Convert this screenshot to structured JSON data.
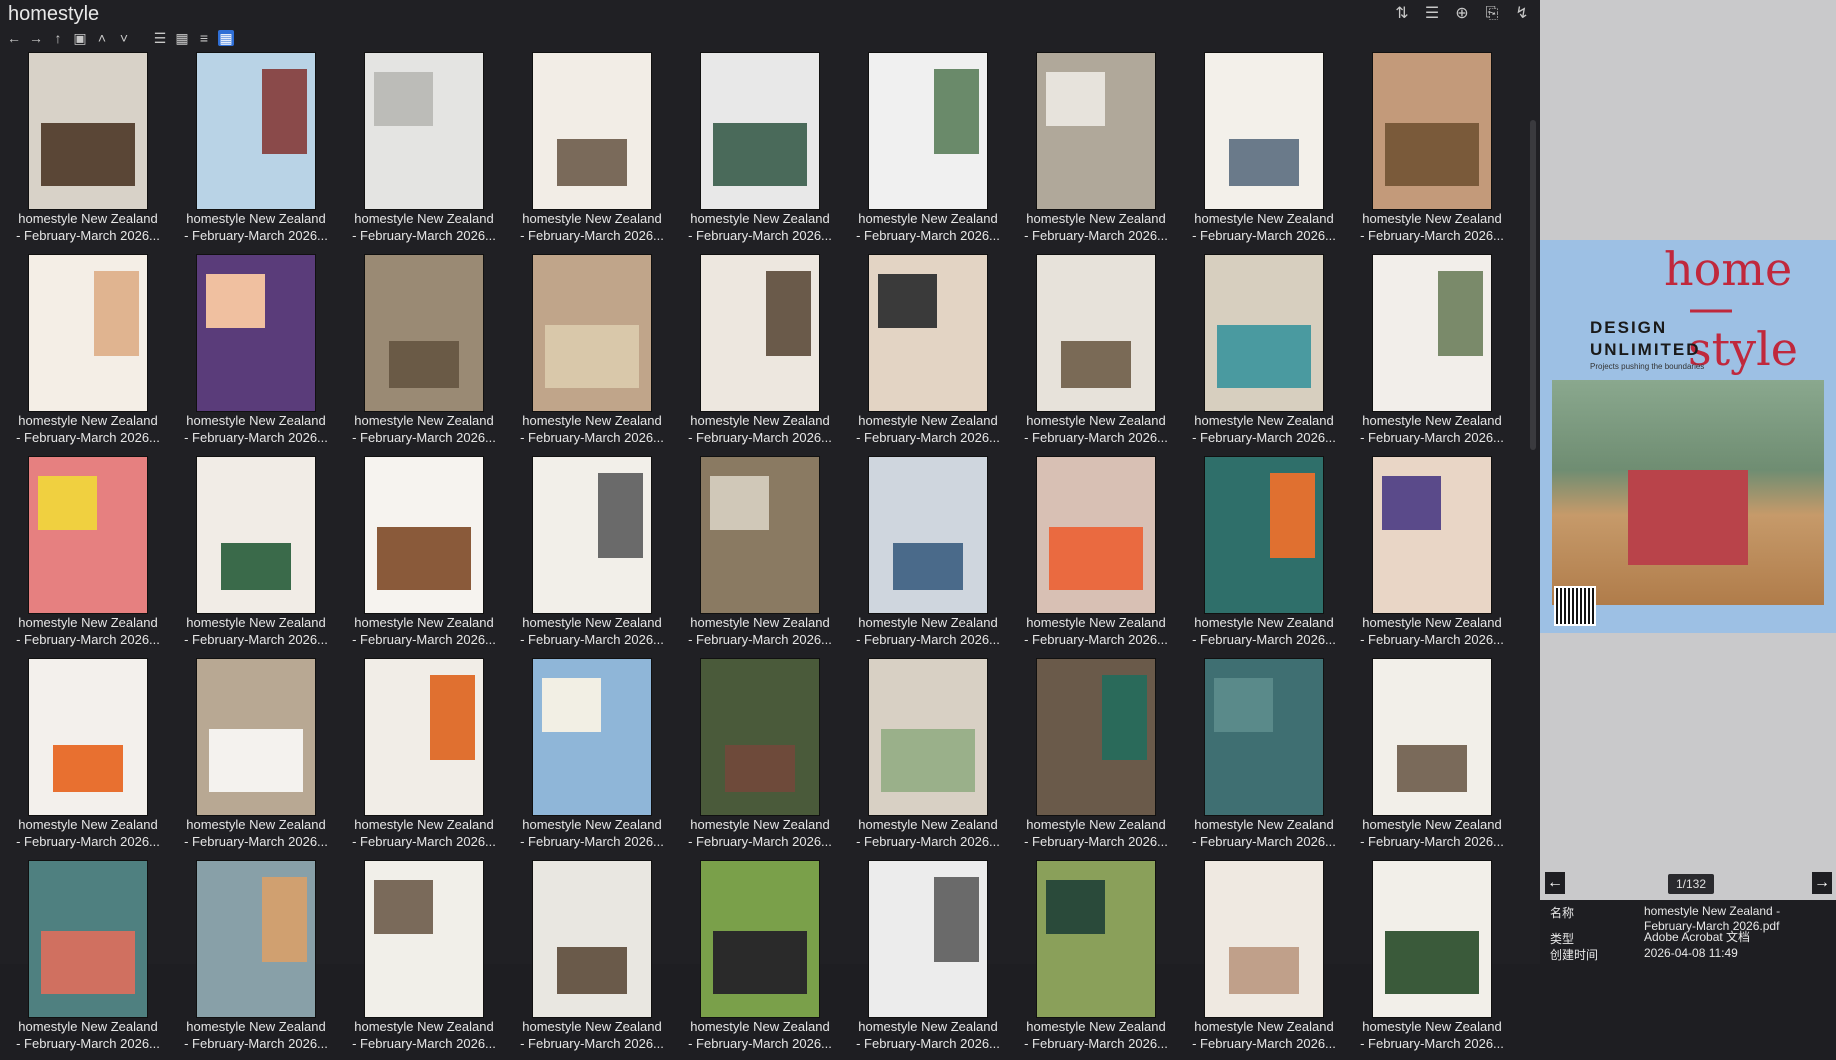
{
  "app": {
    "title": "homestyle"
  },
  "toolbar": {
    "icons": [
      "back-arrow-icon",
      "forward-arrow-icon",
      "up-arrow-icon",
      "crop-icon",
      "chevron-up-icon",
      "chevron-down-icon",
      "list-view-icon",
      "details-view-icon",
      "tree-view-icon",
      "grid-view-icon"
    ],
    "right_icons": [
      "sort-icon",
      "list-options-icon",
      "add-icon",
      "clipboard-icon",
      "bolt-icon"
    ]
  },
  "grid": {
    "caption_line1": "homestyle New Zealand",
    "caption_line2": "- February-March 2026...",
    "thumb_colors": [
      "#d8d2c8",
      "#b9d3e6",
      "#e4e4e2",
      "#f2ede6",
      "#e8e8e8",
      "#f0f0f0",
      "#b0a89a",
      "#f3f0ea",
      "#c39a7a",
      "#f4eee6",
      "#5a3c7a",
      "#9a8a74",
      "#c0a58a",
      "#ede7df",
      "#e3d4c4",
      "#e7e2da",
      "#d7cfbf",
      "#f2eeea",
      "#e68080",
      "#f1ece6",
      "#f6f3ef",
      "#f2efe9",
      "#8a7a62",
      "#cfd6de",
      "#d8c0b4",
      "#2f6f6a",
      "#e9d6c6",
      "#f3f0ec",
      "#b8a893",
      "#f1ede7",
      "#8fb6d8",
      "#4a5a3a",
      "#d8d0c4",
      "#6a5a4a",
      "#3f6f72",
      "#f2efe9",
      "#4f8080",
      "#88a0a8",
      "#f1efe9",
      "#e9e7e1",
      "#7aa04a",
      "#ececec",
      "#8aa05a",
      "#efe9e1",
      "#f2efe9"
    ],
    "thumb_accents": [
      "#5a4636",
      "#8a4a4a",
      "#bcbcb8",
      "#7a6a5a",
      "#4a6a5a",
      "#6a8a6a",
      "#e7e3dc",
      "#6a7a8a",
      "#7a5a3a",
      "#e0b490",
      "#f0c0a0",
      "#6a5a46",
      "#d9c8aa",
      "#6a5a4a",
      "#3a3a3a",
      "#7a6a56",
      "#4a9aa0",
      "#7a8a6a",
      "#f0d040",
      "#3a6a4a",
      "#8a5a3a",
      "#6a6a6a",
      "#d0c8b8",
      "#4a6a8a",
      "#ea6a40",
      "#e07030",
      "#5a4a8a",
      "#e87030",
      "#f4f2ee",
      "#e07030",
      "#f2efe4",
      "#6e4a3a",
      "#9ab08a",
      "#2a6a5a",
      "#5a8a8a",
      "#7a6a5a",
      "#d07060",
      "#d0a070",
      "#7a6a5a",
      "#6a5a4a",
      "#2a2a2a",
      "#6a6a6a",
      "#2a4a3a",
      "#c0a08a",
      "#3a5a3a"
    ]
  },
  "preview": {
    "cover_line1": "home",
    "cover_line2": "—style",
    "cover_sub1": "DESIGN",
    "cover_sub2": "UNLIMITED",
    "cover_tag": "Projects pushing the boundaries",
    "page_indicator": "1/132"
  },
  "info": {
    "name_label": "名称",
    "name_value": "homestyle New Zealand - February-March 2026.pdf",
    "type_label": "类型",
    "type_value": "Adobe Acrobat 文档",
    "created_label": "创建时间",
    "created_value": "2026-04-08 11:49"
  }
}
